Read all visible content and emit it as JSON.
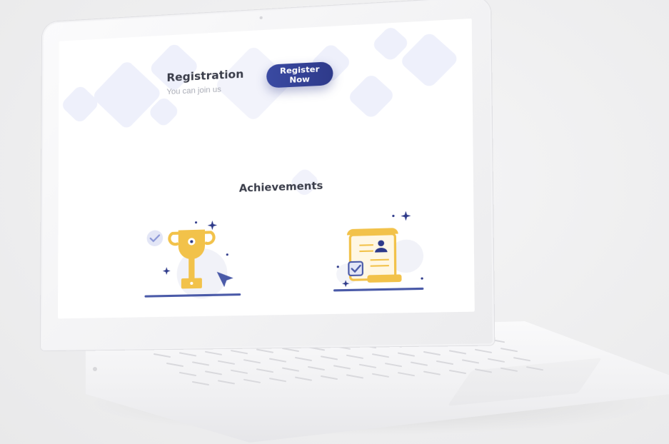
{
  "screen": {
    "registration": {
      "title": "Registration",
      "subtitle": "You can join us",
      "button_label": "Register Now"
    },
    "achievements": {
      "title": "Achievements"
    }
  },
  "colors": {
    "accent": "#2e3a8a",
    "trophy": "#f2c24a",
    "diamond_tint": "#eef0fb",
    "heading": "#3a3d4a"
  },
  "icons": [
    "trophy-icon",
    "check-bubble-icon",
    "cursor-arrow-icon",
    "sparkle-icon",
    "certificate-scroll-icon",
    "user-badge-icon",
    "checkbox-icon"
  ]
}
